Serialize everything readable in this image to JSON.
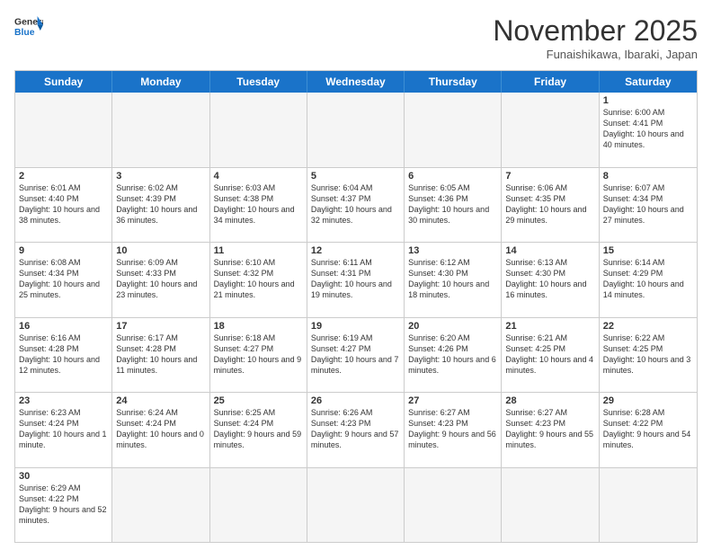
{
  "header": {
    "logo_general": "General",
    "logo_blue": "Blue",
    "month_title": "November 2025",
    "subtitle": "Funaishikawa, Ibaraki, Japan"
  },
  "weekdays": [
    "Sunday",
    "Monday",
    "Tuesday",
    "Wednesday",
    "Thursday",
    "Friday",
    "Saturday"
  ],
  "rows": [
    [
      {
        "day": "",
        "info": ""
      },
      {
        "day": "",
        "info": ""
      },
      {
        "day": "",
        "info": ""
      },
      {
        "day": "",
        "info": ""
      },
      {
        "day": "",
        "info": ""
      },
      {
        "day": "",
        "info": ""
      },
      {
        "day": "1",
        "info": "Sunrise: 6:00 AM\nSunset: 4:41 PM\nDaylight: 10 hours and 40 minutes."
      }
    ],
    [
      {
        "day": "2",
        "info": "Sunrise: 6:01 AM\nSunset: 4:40 PM\nDaylight: 10 hours and 38 minutes."
      },
      {
        "day": "3",
        "info": "Sunrise: 6:02 AM\nSunset: 4:39 PM\nDaylight: 10 hours and 36 minutes."
      },
      {
        "day": "4",
        "info": "Sunrise: 6:03 AM\nSunset: 4:38 PM\nDaylight: 10 hours and 34 minutes."
      },
      {
        "day": "5",
        "info": "Sunrise: 6:04 AM\nSunset: 4:37 PM\nDaylight: 10 hours and 32 minutes."
      },
      {
        "day": "6",
        "info": "Sunrise: 6:05 AM\nSunset: 4:36 PM\nDaylight: 10 hours and 30 minutes."
      },
      {
        "day": "7",
        "info": "Sunrise: 6:06 AM\nSunset: 4:35 PM\nDaylight: 10 hours and 29 minutes."
      },
      {
        "day": "8",
        "info": "Sunrise: 6:07 AM\nSunset: 4:34 PM\nDaylight: 10 hours and 27 minutes."
      }
    ],
    [
      {
        "day": "9",
        "info": "Sunrise: 6:08 AM\nSunset: 4:34 PM\nDaylight: 10 hours and 25 minutes."
      },
      {
        "day": "10",
        "info": "Sunrise: 6:09 AM\nSunset: 4:33 PM\nDaylight: 10 hours and 23 minutes."
      },
      {
        "day": "11",
        "info": "Sunrise: 6:10 AM\nSunset: 4:32 PM\nDaylight: 10 hours and 21 minutes."
      },
      {
        "day": "12",
        "info": "Sunrise: 6:11 AM\nSunset: 4:31 PM\nDaylight: 10 hours and 19 minutes."
      },
      {
        "day": "13",
        "info": "Sunrise: 6:12 AM\nSunset: 4:30 PM\nDaylight: 10 hours and 18 minutes."
      },
      {
        "day": "14",
        "info": "Sunrise: 6:13 AM\nSunset: 4:30 PM\nDaylight: 10 hours and 16 minutes."
      },
      {
        "day": "15",
        "info": "Sunrise: 6:14 AM\nSunset: 4:29 PM\nDaylight: 10 hours and 14 minutes."
      }
    ],
    [
      {
        "day": "16",
        "info": "Sunrise: 6:16 AM\nSunset: 4:28 PM\nDaylight: 10 hours and 12 minutes."
      },
      {
        "day": "17",
        "info": "Sunrise: 6:17 AM\nSunset: 4:28 PM\nDaylight: 10 hours and 11 minutes."
      },
      {
        "day": "18",
        "info": "Sunrise: 6:18 AM\nSunset: 4:27 PM\nDaylight: 10 hours and 9 minutes."
      },
      {
        "day": "19",
        "info": "Sunrise: 6:19 AM\nSunset: 4:27 PM\nDaylight: 10 hours and 7 minutes."
      },
      {
        "day": "20",
        "info": "Sunrise: 6:20 AM\nSunset: 4:26 PM\nDaylight: 10 hours and 6 minutes."
      },
      {
        "day": "21",
        "info": "Sunrise: 6:21 AM\nSunset: 4:25 PM\nDaylight: 10 hours and 4 minutes."
      },
      {
        "day": "22",
        "info": "Sunrise: 6:22 AM\nSunset: 4:25 PM\nDaylight: 10 hours and 3 minutes."
      }
    ],
    [
      {
        "day": "23",
        "info": "Sunrise: 6:23 AM\nSunset: 4:24 PM\nDaylight: 10 hours and 1 minute."
      },
      {
        "day": "24",
        "info": "Sunrise: 6:24 AM\nSunset: 4:24 PM\nDaylight: 10 hours and 0 minutes."
      },
      {
        "day": "25",
        "info": "Sunrise: 6:25 AM\nSunset: 4:24 PM\nDaylight: 9 hours and 59 minutes."
      },
      {
        "day": "26",
        "info": "Sunrise: 6:26 AM\nSunset: 4:23 PM\nDaylight: 9 hours and 57 minutes."
      },
      {
        "day": "27",
        "info": "Sunrise: 6:27 AM\nSunset: 4:23 PM\nDaylight: 9 hours and 56 minutes."
      },
      {
        "day": "28",
        "info": "Sunrise: 6:27 AM\nSunset: 4:23 PM\nDaylight: 9 hours and 55 minutes."
      },
      {
        "day": "29",
        "info": "Sunrise: 6:28 AM\nSunset: 4:22 PM\nDaylight: 9 hours and 54 minutes."
      }
    ],
    [
      {
        "day": "30",
        "info": "Sunrise: 6:29 AM\nSunset: 4:22 PM\nDaylight: 9 hours and 52 minutes."
      },
      {
        "day": "",
        "info": ""
      },
      {
        "day": "",
        "info": ""
      },
      {
        "day": "",
        "info": ""
      },
      {
        "day": "",
        "info": ""
      },
      {
        "day": "",
        "info": ""
      },
      {
        "day": "",
        "info": ""
      }
    ]
  ]
}
